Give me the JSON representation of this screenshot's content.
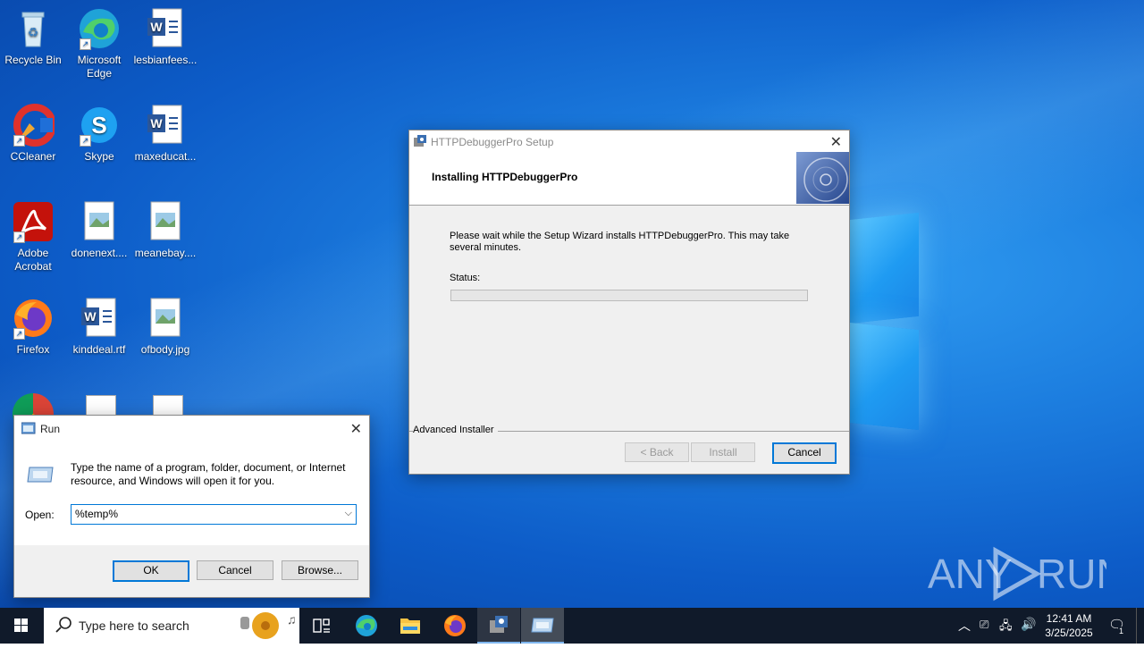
{
  "desktop": {
    "icons": [
      {
        "label": "Recycle Bin",
        "icon": "recycle-bin-icon"
      },
      {
        "label": "Microsoft Edge",
        "icon": "edge-icon"
      },
      {
        "label": "lesbianfees...",
        "icon": "word-document-icon"
      },
      {
        "label": "CCleaner",
        "icon": "ccleaner-icon"
      },
      {
        "label": "Skype",
        "icon": "skype-icon"
      },
      {
        "label": "maxeducat...",
        "icon": "word-document-icon"
      },
      {
        "label": "Adobe Acrobat",
        "icon": "acrobat-icon"
      },
      {
        "label": "donenext....",
        "icon": "image-file-icon"
      },
      {
        "label": "meanebay....",
        "icon": "image-file-icon"
      },
      {
        "label": "Firefox",
        "icon": "firefox-icon"
      },
      {
        "label": "kinddeal.rtf",
        "icon": "word-document-icon"
      },
      {
        "label": "ofbody.jpg",
        "icon": "image-file-icon"
      }
    ],
    "watermark": "ANY RUN"
  },
  "setup": {
    "title": "HTTPDebuggerPro Setup",
    "heading": "Installing HTTPDebuggerPro",
    "message": "Please wait while the Setup Wizard installs HTTPDebuggerPro.  This may take several minutes.",
    "status_label": "Status:",
    "progress": 0,
    "footer_brand": "Advanced Installer",
    "back_label": "< Back",
    "install_label": "Install",
    "cancel_label": "Cancel"
  },
  "run": {
    "title": "Run",
    "description": "Type the name of a program, folder, document, or Internet resource, and Windows will open it for you.",
    "open_label": "Open:",
    "open_value": "%temp%",
    "ok_label": "OK",
    "cancel_label": "Cancel",
    "browse_label": "Browse..."
  },
  "taskbar": {
    "search_placeholder": "Type here to search",
    "time": "12:41 AM",
    "date": "3/25/2025",
    "notification_count": "1"
  },
  "colors": {
    "accent": "#0078d7",
    "taskbar": "#101a2a",
    "desktop": "#0d5cc8"
  }
}
